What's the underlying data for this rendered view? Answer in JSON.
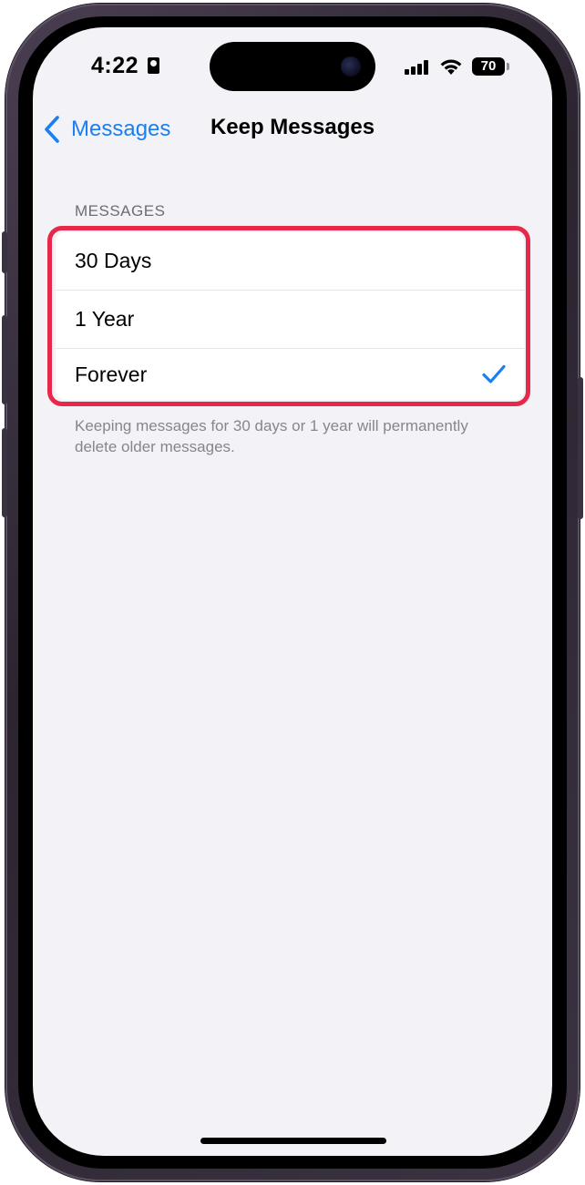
{
  "status_bar": {
    "time": "4:22",
    "battery_level": "70"
  },
  "nav": {
    "back_label": "Messages",
    "title": "Keep Messages"
  },
  "section": {
    "header": "MESSAGES",
    "options": [
      {
        "label": "30 Days",
        "selected": false
      },
      {
        "label": "1 Year",
        "selected": false
      },
      {
        "label": "Forever",
        "selected": true
      }
    ],
    "footer": "Keeping messages for 30 days or 1 year will permanently delete older messages."
  },
  "colors": {
    "accent": "#1a7ff0",
    "highlight": "#e8284a",
    "background": "#f2f2f7"
  },
  "icons": {
    "back": "chevron-left-icon",
    "selected": "checkmark-icon",
    "focus": "person-badge-icon",
    "signal": "cellular-signal-icon",
    "wifi": "wifi-icon",
    "battery": "battery-icon"
  }
}
